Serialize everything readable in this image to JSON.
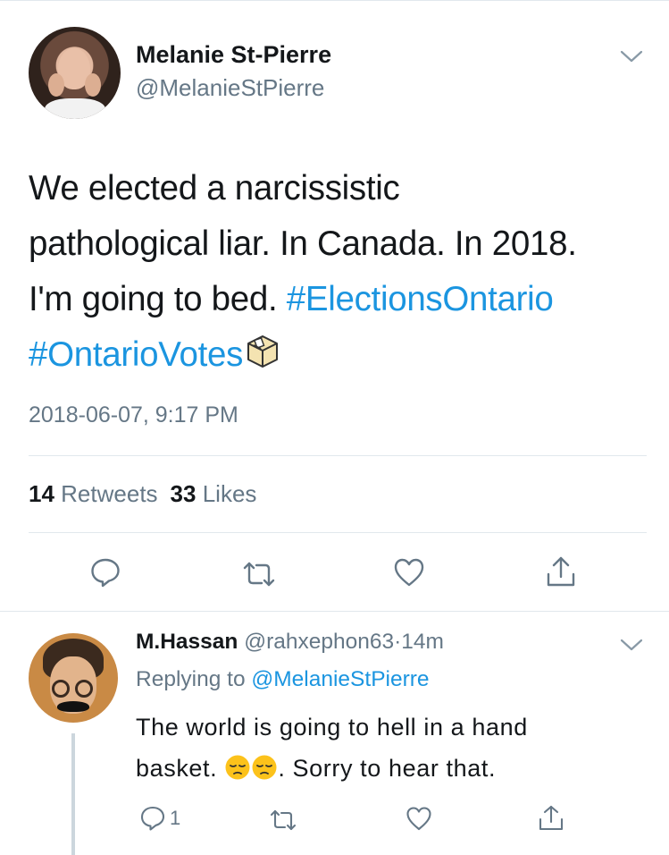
{
  "main_tweet": {
    "author_name": "Melanie St-Pierre",
    "author_handle": "@MelanieStPierre",
    "text_line1": "We elected a narcissistic",
    "text_line2": "pathological liar. In Canada. In 2018.",
    "text_line3_plain": "I'm going to bed. ",
    "text_line3_tag": "#ElectionsOntario",
    "text_line4_tag": "#OntarioVotes",
    "trailing_icon": "ballot-box-icon",
    "timestamp": "2018-06-07, 9:17 PM",
    "retweets_count": "14",
    "retweets_label": "Retweets",
    "likes_count": "33",
    "likes_label": "Likes",
    "actions": [
      "reply-icon",
      "retweet-icon",
      "like-icon",
      "share-icon"
    ]
  },
  "reply": {
    "author_name": "M.Hassan",
    "author_handle": "@rahxephon63",
    "separator": "·",
    "time_ago": "14m",
    "replying_label": "Replying to ",
    "replying_to": "@MelanieStPierre",
    "text_line1": "The world is going to hell in a hand",
    "text_line2_a": "basket. ",
    "text_line2_b": ". Sorry to hear that.",
    "emojis": [
      "pensive-face-icon",
      "pensive-face-icon"
    ],
    "reply_count": "1",
    "actions": [
      "reply-icon",
      "retweet-icon",
      "like-icon",
      "share-icon"
    ]
  },
  "colors": {
    "link": "#1b95e0",
    "secondary_text": "#657786",
    "primary_text": "#14171a",
    "divider": "#e1e8ed"
  }
}
